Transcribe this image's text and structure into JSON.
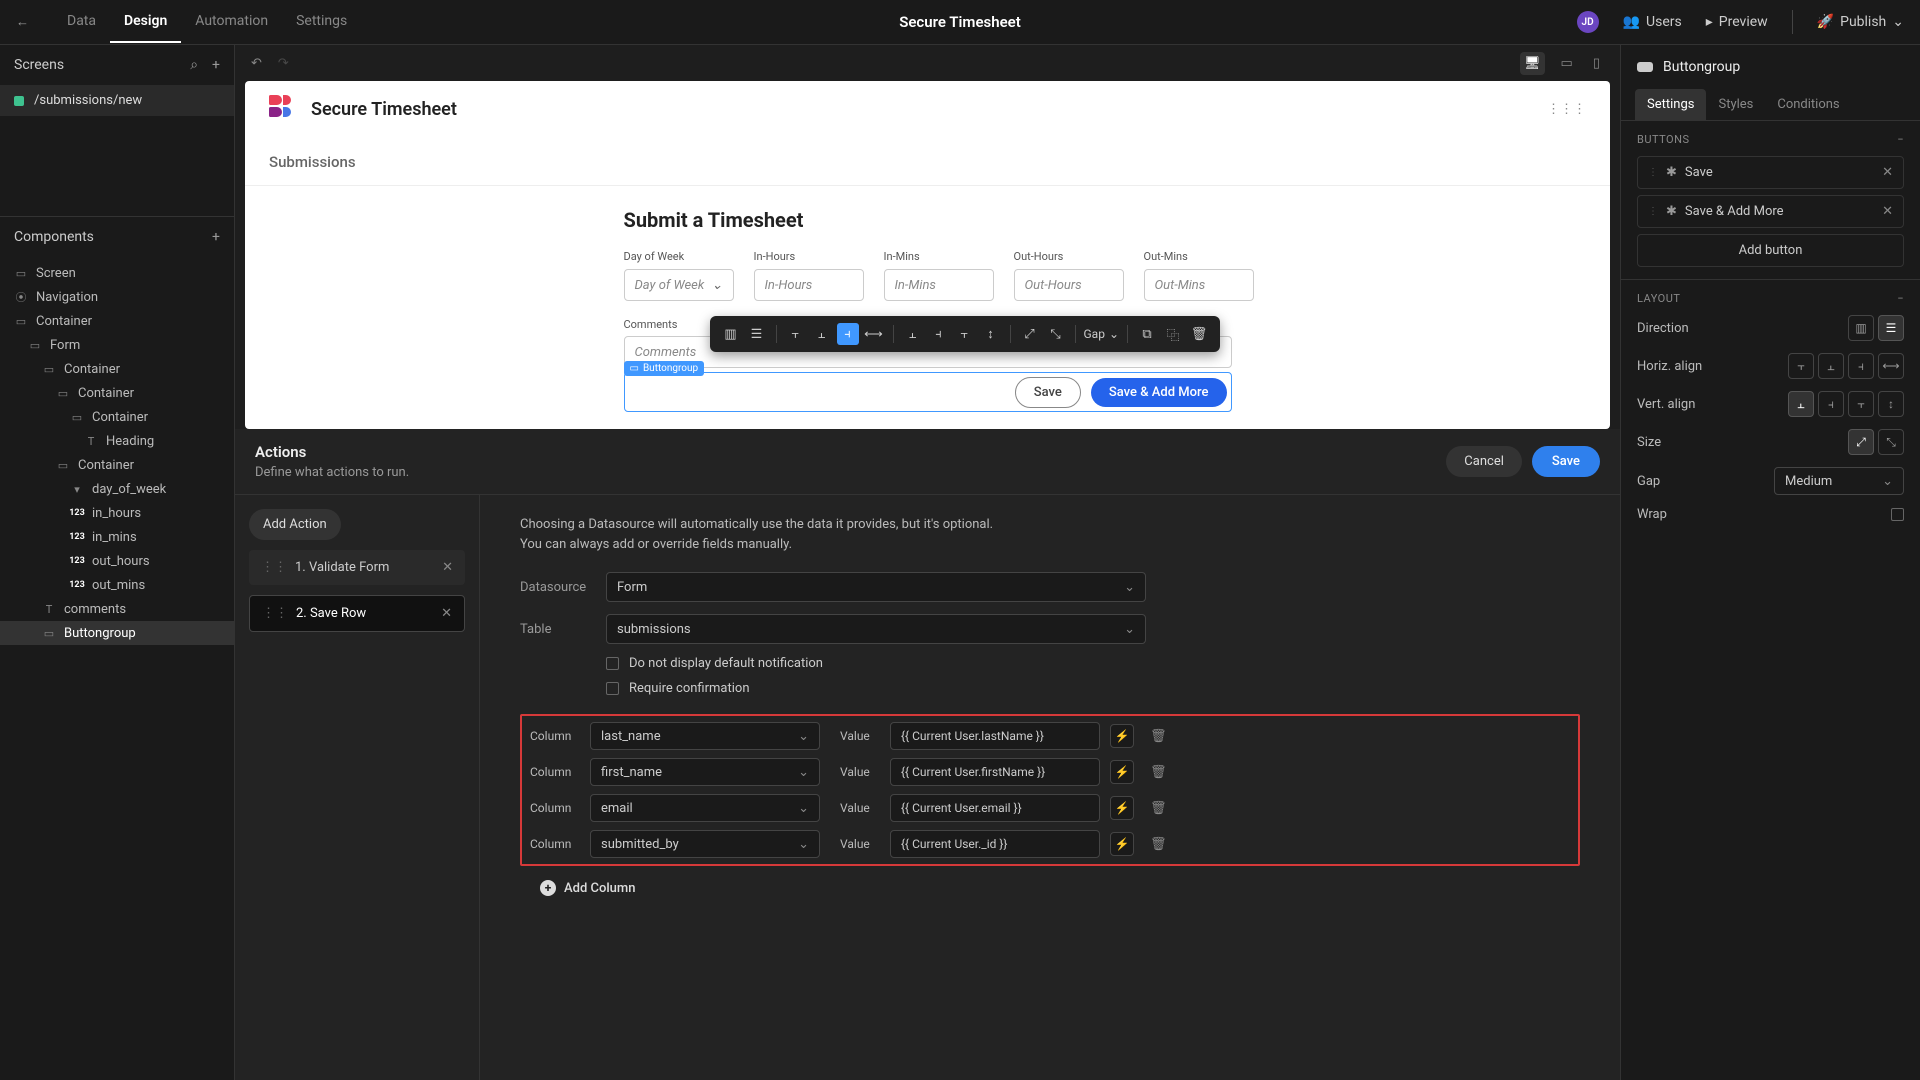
{
  "topbar": {
    "tabs": {
      "data": "Data",
      "design": "Design",
      "automation": "Automation",
      "settings": "Settings"
    },
    "title": "Secure Timesheet",
    "avatar": "JD",
    "users": "Users",
    "preview": "Preview",
    "publish": "Publish"
  },
  "left": {
    "screens_header": "Screens",
    "screen_item": "/submissions/new",
    "components_header": "Components",
    "tree": {
      "screen": "Screen",
      "navigation": "Navigation",
      "container1": "Container",
      "form": "Form",
      "container2": "Container",
      "container3": "Container",
      "container4": "Container",
      "heading": "Heading",
      "container5": "Container",
      "day_of_week": "day_of_week",
      "in_hours": "in_hours",
      "in_mins": "in_mins",
      "out_hours": "out_hours",
      "out_mins": "out_mins",
      "comments": "comments",
      "buttongroup": "Buttongroup"
    }
  },
  "canvas": {
    "app_name": "Secure Timesheet",
    "subheader": "Submissions",
    "form_title": "Submit a Timesheet",
    "fields": {
      "dow_label": "Day of Week",
      "dow_placeholder": "Day of Week",
      "inh_label": "In-Hours",
      "inh_placeholder": "In-Hours",
      "inm_label": "In-Mins",
      "inm_placeholder": "In-Mins",
      "outh_label": "Out-Hours",
      "outh_placeholder": "Out-Hours",
      "outm_label": "Out-Mins",
      "outm_placeholder": "Out-Mins",
      "comments_label": "Comments",
      "comments_placeholder": "Comments"
    },
    "float_gap": "Gap",
    "tag": "Buttongroup",
    "btn_save": "Save",
    "btn_save_more": "Save & Add More"
  },
  "actions": {
    "title": "Actions",
    "subtitle": "Define what actions to run.",
    "cancel": "Cancel",
    "save": "Save",
    "add_action": "Add Action",
    "items": {
      "a1": "1. Validate Form",
      "a2": "2. Save Row"
    },
    "hint1": "Choosing a Datasource will automatically use the data it provides, but it's optional.",
    "hint2": "You can always add or override fields manually.",
    "labels": {
      "datasource": "Datasource",
      "table": "Table",
      "column": "Column",
      "value": "Value"
    },
    "datasource_val": "Form",
    "table_val": "submissions",
    "cb1": "Do not display default notification",
    "cb2": "Require confirmation",
    "columns": [
      {
        "col": "last_name",
        "val": "{{ Current User.lastName }}"
      },
      {
        "col": "first_name",
        "val": "{{ Current User.firstName }}"
      },
      {
        "col": "email",
        "val": "{{ Current User.email }}"
      },
      {
        "col": "submitted_by",
        "val": "{{ Current User._id }}"
      }
    ],
    "add_column": "Add Column"
  },
  "right": {
    "title": "Buttongroup",
    "tabs": {
      "settings": "Settings",
      "styles": "Styles",
      "conditions": "Conditions"
    },
    "buttons_header": "BUTTONS",
    "btn1": "Save",
    "btn2": "Save & Add More",
    "add_button": "Add button",
    "layout_header": "LAYOUT",
    "direction": "Direction",
    "halign": "Horiz. align",
    "valign": "Vert. align",
    "size": "Size",
    "gap": "Gap",
    "gap_val": "Medium",
    "wrap": "Wrap"
  }
}
